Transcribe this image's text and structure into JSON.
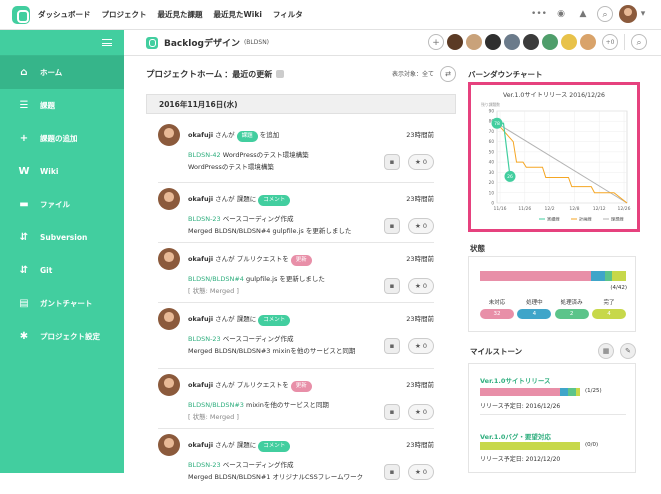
{
  "topnav": {
    "dashboard": "ダッシュボード",
    "project": "プロジェクト",
    "recent_issues": "最近見た課題",
    "recent_wiki": "最近見たWiki",
    "filter": "フィルタ"
  },
  "colors": {
    "brand": "#42ce9f",
    "highlight": "#e6417e",
    "open": "#e88fa8",
    "in_progress": "#3fa5c9",
    "resolved": "#5cc48a",
    "closed": "#c7d84a"
  },
  "sidebar": {
    "items": [
      {
        "label": "ホーム",
        "icon": "home-icon"
      },
      {
        "label": "課題",
        "icon": "list-icon"
      },
      {
        "label": "課題の追加",
        "icon": "plus-icon"
      },
      {
        "label": "Wiki",
        "icon": "wiki-icon"
      },
      {
        "label": "ファイル",
        "icon": "folder-icon"
      },
      {
        "label": "Subversion",
        "icon": "svn-icon"
      },
      {
        "label": "Git",
        "icon": "git-icon"
      },
      {
        "label": "ガントチャート",
        "icon": "gantt-icon"
      },
      {
        "label": "プロジェクト設定",
        "icon": "gear-icon"
      }
    ]
  },
  "project": {
    "name": "Backlogデザイン",
    "key": "(BLDSN)",
    "more_members": "+0"
  },
  "main": {
    "title": "プロジェクトホーム",
    "subtitle": "：最近の更新",
    "view_label": "表示対象：全て",
    "date": "2016年11月16日(水)"
  },
  "activities": [
    {
      "user": "okafuji",
      "pre": "さんが",
      "tag": "課題",
      "tag_color": "#42ce9f",
      "post": "を追加",
      "time": "23時間前",
      "key": "BLDSN-42",
      "l2": "WordPressのテスト環境構築",
      "l3": "WordPressのテスト環境構築",
      "stars": "0"
    },
    {
      "user": "okafuji",
      "pre": "さんが 課題に",
      "tag": "コメント",
      "tag_color": "#42ce9f",
      "post": "",
      "time": "23時間前",
      "key": "BLDSN-23",
      "l2": "ベースコーディング作成",
      "l3": "Merged BLDSN/BLDSN#4 gulpfile.js を更新しました",
      "stars": "0"
    },
    {
      "user": "okafuji",
      "pre": "さんが プルリクエストを",
      "tag": "更新",
      "tag_color": "#e88fa8",
      "post": "",
      "time": "23時間前",
      "key": "BLDSN/BLDSN#4",
      "l2": "gulpfile.js を更新しました",
      "l3": "[ 状態: Merged ]",
      "stars": "0"
    },
    {
      "user": "okafuji",
      "pre": "さんが 課題に",
      "tag": "コメント",
      "tag_color": "#42ce9f",
      "post": "",
      "time": "23時間前",
      "key": "BLDSN-23",
      "l2": "ベースコーディング作成",
      "l3": "Merged BLDSN/BLDSN#3 mixinを他のサービスと同期",
      "stars": "0"
    },
    {
      "user": "okafuji",
      "pre": "さんが プルリクエストを",
      "tag": "更新",
      "tag_color": "#e88fa8",
      "post": "",
      "time": "23時間前",
      "key": "BLDSN/BLDSN#3",
      "l2": "mixinを他のサービスと同期",
      "l3": "[ 状態: Merged ]",
      "stars": "0"
    },
    {
      "user": "okafuji",
      "pre": "さんが 課題に",
      "tag": "コメント",
      "tag_color": "#42ce9f",
      "post": "",
      "time": "23時間前",
      "key": "BLDSN-23",
      "l2": "ベースコーディング作成",
      "l3": "Merged BLDSN/BLDSN#1 オリジナルCSSフレームワーク",
      "stars": "0"
    }
  ],
  "burndown": {
    "heading": "バーンダウンチャート",
    "chart_title": "Ver.1.0サイトリリース 2016/12/26",
    "yaxis_caption": "残り課題数",
    "legend": [
      "実績線",
      "計画線",
      "理想線"
    ]
  },
  "chart_data": {
    "type": "line",
    "title": "Ver.1.0サイトリリース 2016/12/26",
    "ylabel": "残り課題数",
    "ylim": [
      0,
      90
    ],
    "yticks": [
      0,
      10,
      20,
      30,
      40,
      50,
      60,
      70,
      80,
      90
    ],
    "xticks": [
      "11/16",
      "11/26",
      "12/2",
      "12/8",
      "12/12",
      "12/26"
    ],
    "series": [
      {
        "name": "実績線",
        "color": "#42ce9f",
        "points": [
          [
            0,
            78
          ],
          [
            2,
            78
          ],
          [
            3,
            52
          ],
          [
            4,
            26
          ],
          [
            5,
            26
          ]
        ]
      },
      {
        "name": "計画線",
        "color": "#f5a623",
        "points": [
          [
            0,
            78
          ],
          [
            5,
            60
          ],
          [
            6,
            40
          ],
          [
            8,
            40
          ],
          [
            9,
            35
          ],
          [
            14,
            35
          ],
          [
            15,
            25
          ],
          [
            22,
            25
          ],
          [
            23,
            16
          ],
          [
            29,
            16
          ],
          [
            30,
            10
          ],
          [
            36,
            10
          ],
          [
            40,
            0
          ]
        ]
      },
      {
        "name": "理想線",
        "color": "#b3b3b3",
        "points": [
          [
            0,
            78
          ],
          [
            40,
            0
          ]
        ]
      }
    ],
    "point_labels": [
      {
        "x": 0,
        "y": 78,
        "text": "78"
      },
      {
        "x": 4,
        "y": 26,
        "text": "26"
      }
    ],
    "x_domain": [
      0,
      40
    ]
  },
  "status": {
    "heading": "状態",
    "count": "(4/42)",
    "bar": [
      32,
      4,
      2,
      4
    ],
    "labels": [
      "未対応",
      "処理中",
      "処理済み",
      "完了"
    ],
    "values": [
      "32",
      "4",
      "2",
      "4"
    ]
  },
  "milestones": {
    "heading": "マイルストーン",
    "items": [
      {
        "name": "Ver.1.0サイトリリース",
        "count": "(1/25)",
        "due": "リリース予定日: 2016/12/26",
        "bar": [
          20,
          2,
          2,
          1
        ]
      },
      {
        "name": "Ver.1.0バグ・要望対応",
        "count": "(0/0)",
        "due": "リリース予定日: 2012/12/20",
        "bar": [
          0,
          0,
          0,
          1
        ]
      }
    ]
  }
}
